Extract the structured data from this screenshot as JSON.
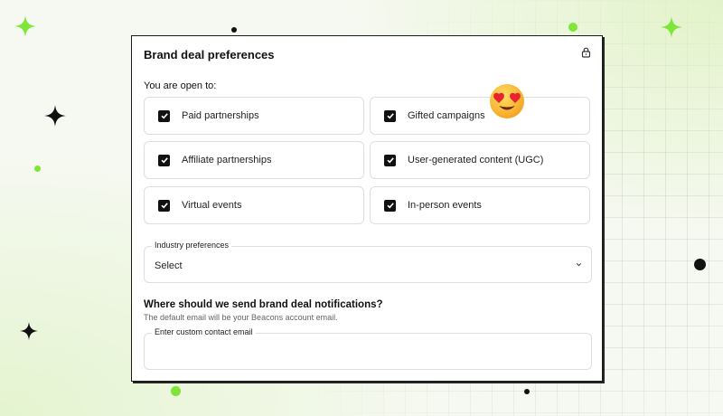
{
  "card": {
    "title": "Brand deal preferences",
    "lock_icon": "lock-icon"
  },
  "preferences": {
    "label": "You are open to:",
    "options": [
      {
        "label": "Paid partnerships",
        "checked": true
      },
      {
        "label": "Gifted campaigns",
        "checked": true
      },
      {
        "label": "Affiliate partnerships",
        "checked": true
      },
      {
        "label": "User-generated content (UGC)",
        "checked": true
      },
      {
        "label": "Virtual events",
        "checked": true
      },
      {
        "label": "In-person events",
        "checked": true
      }
    ]
  },
  "industry": {
    "legend": "Industry preferences",
    "value": "Select",
    "icon": "chevron-down-icon"
  },
  "notifications": {
    "title": "Where should we send brand deal notifications?",
    "subtitle": "The default email will be your Beacons account email.",
    "email_legend": "Enter custom contact email",
    "email_value": ""
  },
  "decor": {
    "emoji": "heart-eyes-emoji",
    "accent": "#7ee53a",
    "ink": "#111111"
  }
}
